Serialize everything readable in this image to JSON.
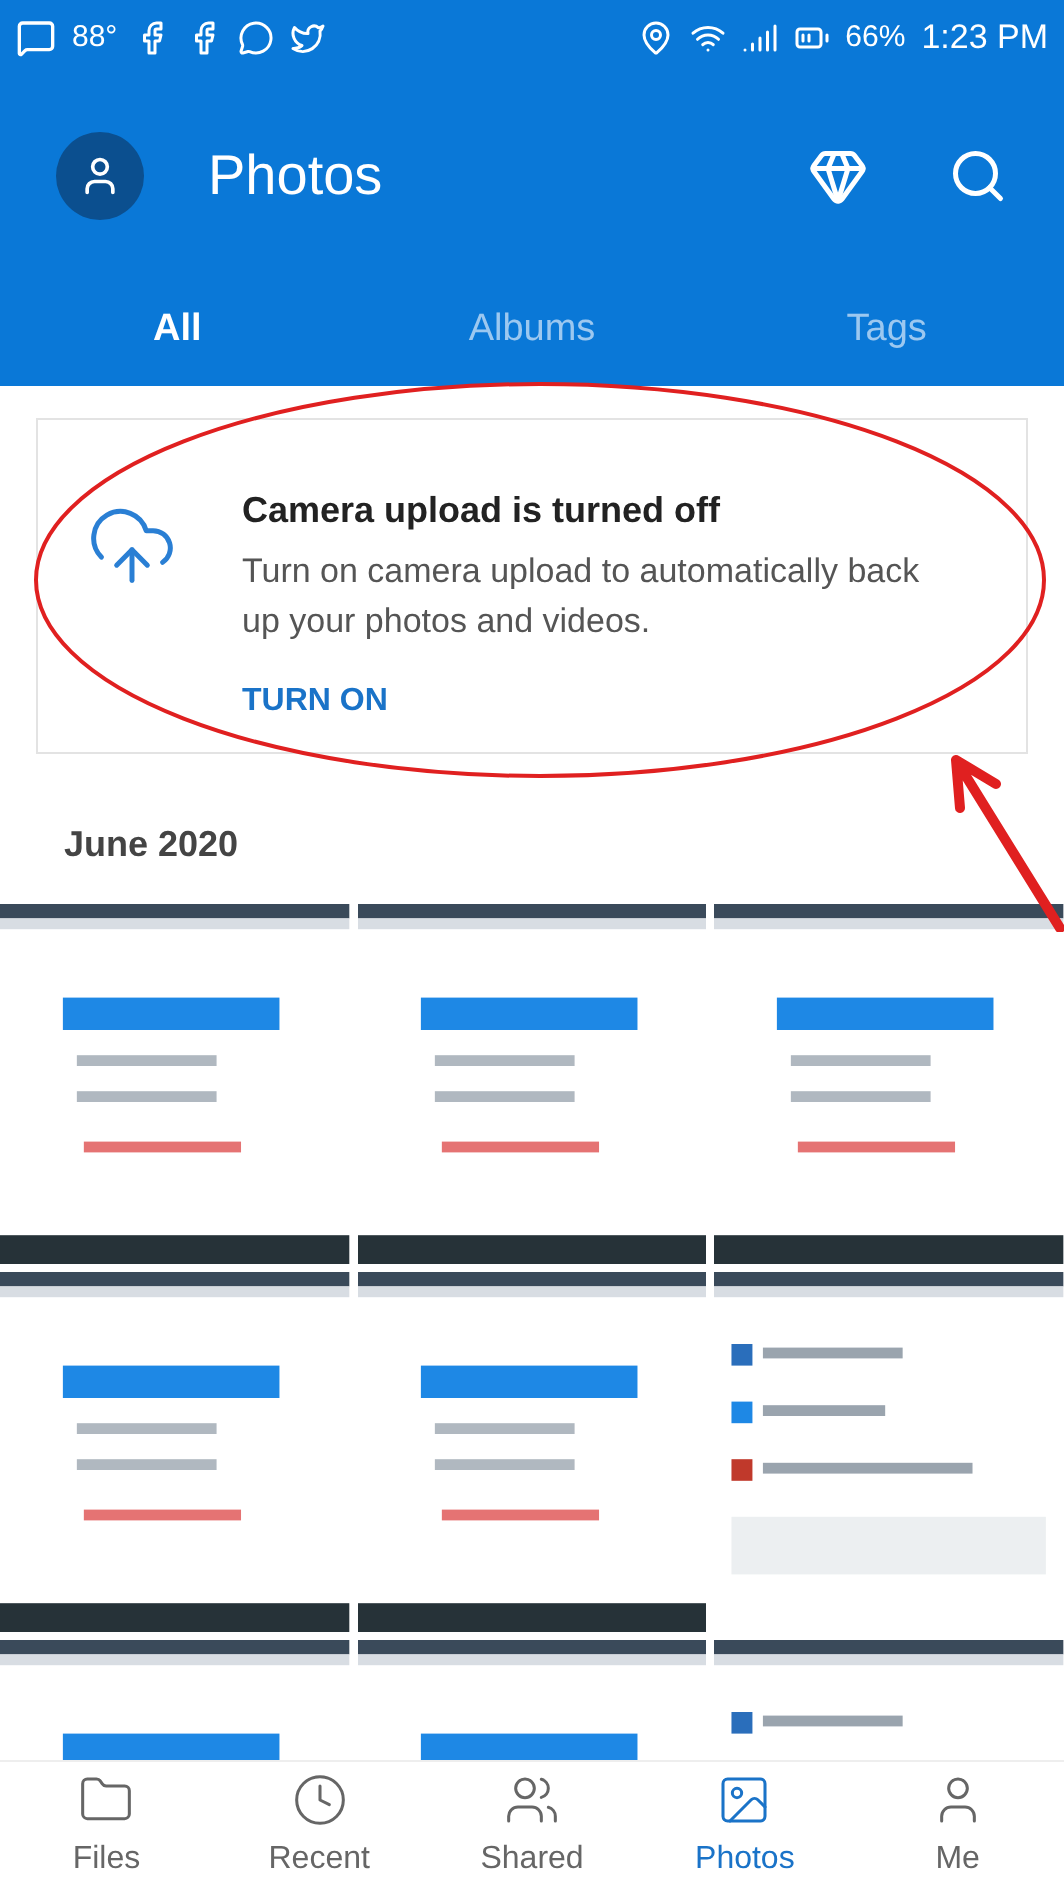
{
  "status_bar": {
    "temperature": "88°",
    "battery": "66%",
    "time": "1:23 PM"
  },
  "header": {
    "title": "Photos"
  },
  "tabs": [
    {
      "label": "All",
      "selected": true
    },
    {
      "label": "Albums",
      "selected": false
    },
    {
      "label": "Tags",
      "selected": false
    }
  ],
  "upload_card": {
    "title": "Camera upload is turned off",
    "message": "Turn on camera upload to automatically back up your photos and videos.",
    "action": "TURN ON"
  },
  "section": {
    "title": "June 2020"
  },
  "bottom_nav": [
    {
      "label": "Files",
      "selected": false
    },
    {
      "label": "Recent",
      "selected": false
    },
    {
      "label": "Shared",
      "selected": false
    },
    {
      "label": "Photos",
      "selected": true
    },
    {
      "label": "Me",
      "selected": false
    }
  ]
}
